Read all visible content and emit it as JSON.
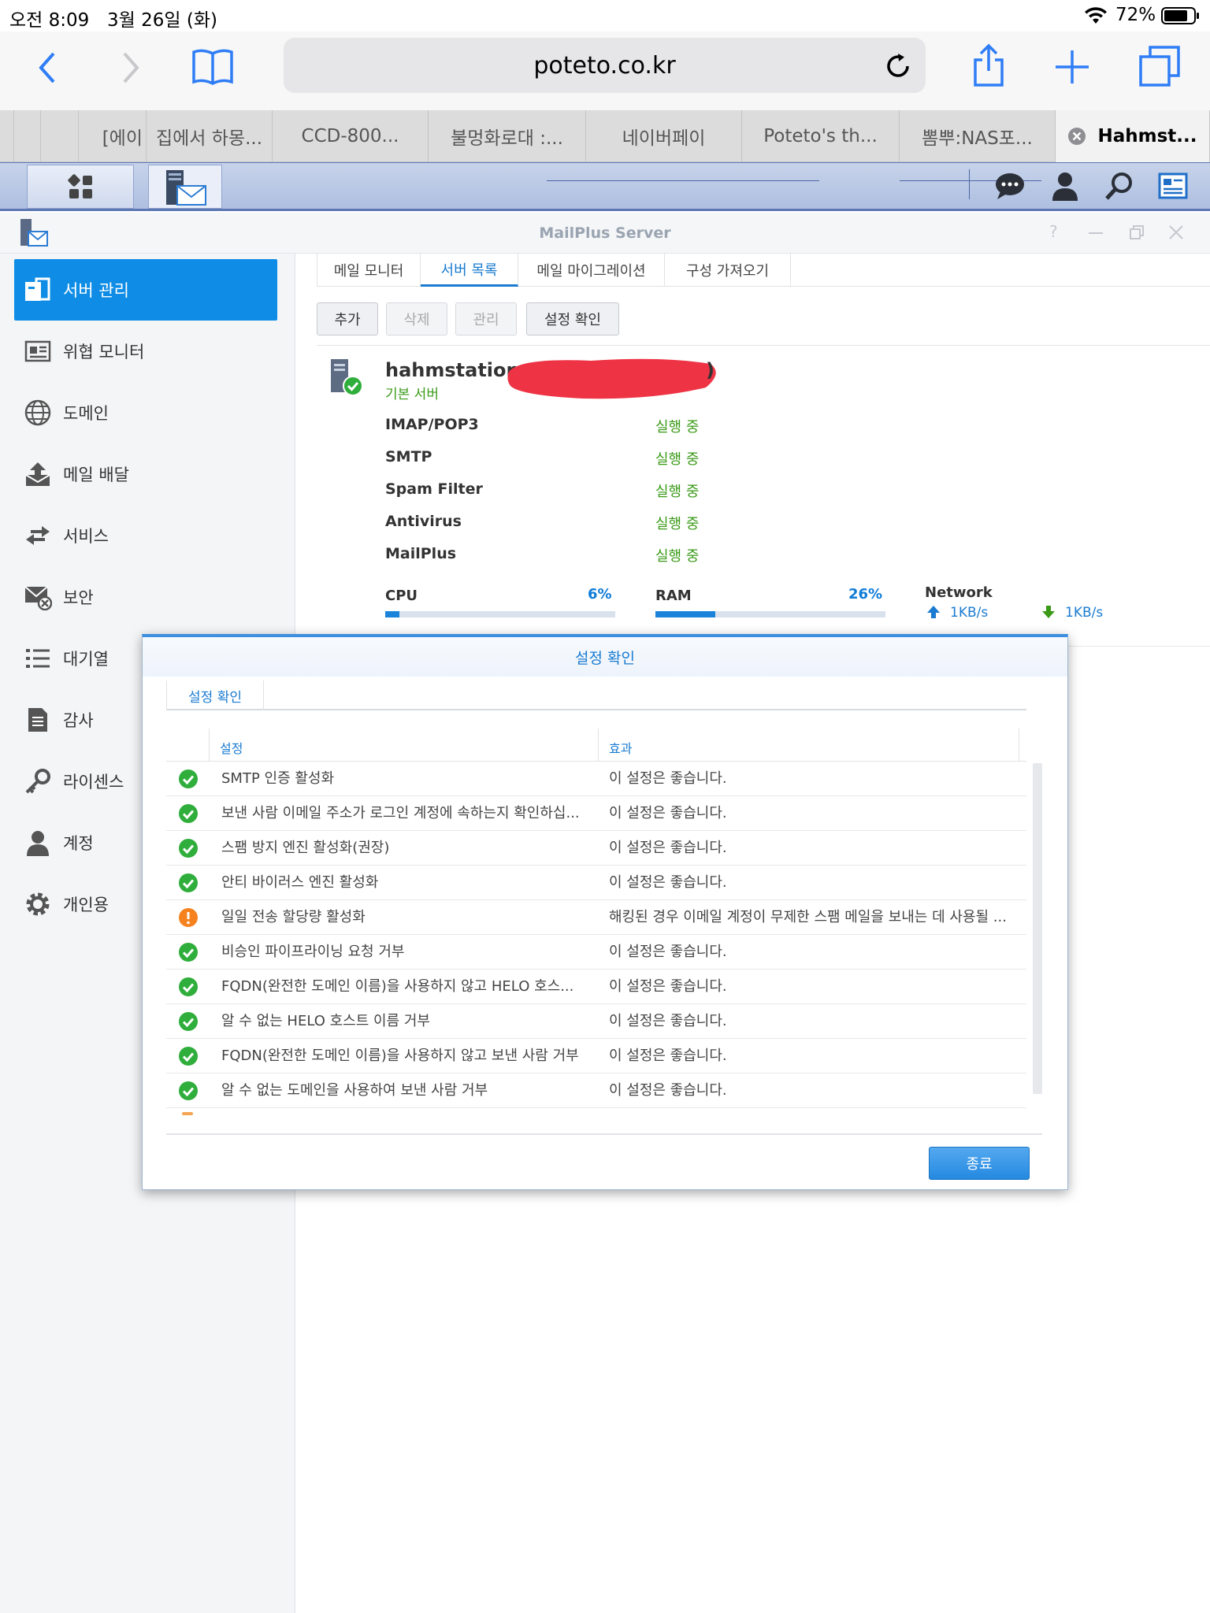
{
  "status_bar": {
    "time": "오전 8:09",
    "date": "3월 26일 (화)",
    "battery": "72%"
  },
  "browser": {
    "url": "poteto.co.kr",
    "tabs": [
      "[에이",
      "집에서 하몽...",
      "CCD-800...",
      "불멍화로대 :...",
      "네이버페이",
      "Poteto's th...",
      "뽐뿌:NAS포...",
      "Hahmst..."
    ]
  },
  "window": {
    "title": "MailPlus Server"
  },
  "sidebar": {
    "items": [
      "서버 관리",
      "위협 모니터",
      "도메인",
      "메일 배달",
      "서비스",
      "보안",
      "대기열",
      "감사",
      "라이센스",
      "계정",
      "개인용"
    ]
  },
  "subtabs": [
    "메일 모니터",
    "서버 목록",
    "메일 마이그레이션",
    "구성 가져오기"
  ],
  "buttons": {
    "add": "추가",
    "delete": "삭제",
    "manage": "관리",
    "check": "설정 확인"
  },
  "server": {
    "name": "hahmstation",
    "name_suffix": ")",
    "role": "기본 서버",
    "services": [
      {
        "name": "IMAP/POP3",
        "status": "실행 중"
      },
      {
        "name": "SMTP",
        "status": "실행 중"
      },
      {
        "name": "Spam Filter",
        "status": "실행 중"
      },
      {
        "name": "Antivirus",
        "status": "실행 중"
      },
      {
        "name": "MailPlus",
        "status": "실행 중"
      }
    ],
    "cpu_label": "CPU",
    "cpu_pct": "6%",
    "cpu_value": 6,
    "ram_label": "RAM",
    "ram_pct": "26%",
    "ram_value": 26,
    "network_label": "Network",
    "up": "1KB/s",
    "down": "1KB/s"
  },
  "modal": {
    "title": "설정 확인",
    "tab": "설정 확인",
    "col_setting": "설정",
    "col_effect": "효과",
    "rows": [
      {
        "status": "ok",
        "setting": "SMTP 인증 활성화",
        "effect": "이 설정은 좋습니다."
      },
      {
        "status": "ok",
        "setting": "보낸 사람 이메일 주소가 로그인 계정에 속하는지 확인하십...",
        "effect": "이 설정은 좋습니다."
      },
      {
        "status": "ok",
        "setting": "스팸 방지 엔진 활성화(권장)",
        "effect": "이 설정은 좋습니다."
      },
      {
        "status": "ok",
        "setting": "안티 바이러스 엔진 활성화",
        "effect": "이 설정은 좋습니다."
      },
      {
        "status": "warn",
        "setting": "일일 전송 할당량 활성화",
        "effect": "해킹된 경우 이메일 계정이 무제한 스팸 메일을 보내는 데 사용될 ..."
      },
      {
        "status": "ok",
        "setting": "비승인 파이프라이닝 요청 거부",
        "effect": "이 설정은 좋습니다."
      },
      {
        "status": "ok",
        "setting": "FQDN(완전한 도메인 이름)을 사용하지 않고 HELO 호스...",
        "effect": "이 설정은 좋습니다."
      },
      {
        "status": "ok",
        "setting": "알 수 없는 HELO 호스트 이름 거부",
        "effect": "이 설정은 좋습니다."
      },
      {
        "status": "ok",
        "setting": "FQDN(완전한 도메인 이름)을 사용하지 않고 보낸 사람 거부",
        "effect": "이 설정은 좋습니다."
      },
      {
        "status": "ok",
        "setting": "알 수 없는 도메인을 사용하여 보낸 사람 거부",
        "effect": "이 설정은 좋습니다."
      }
    ],
    "close": "종료"
  }
}
